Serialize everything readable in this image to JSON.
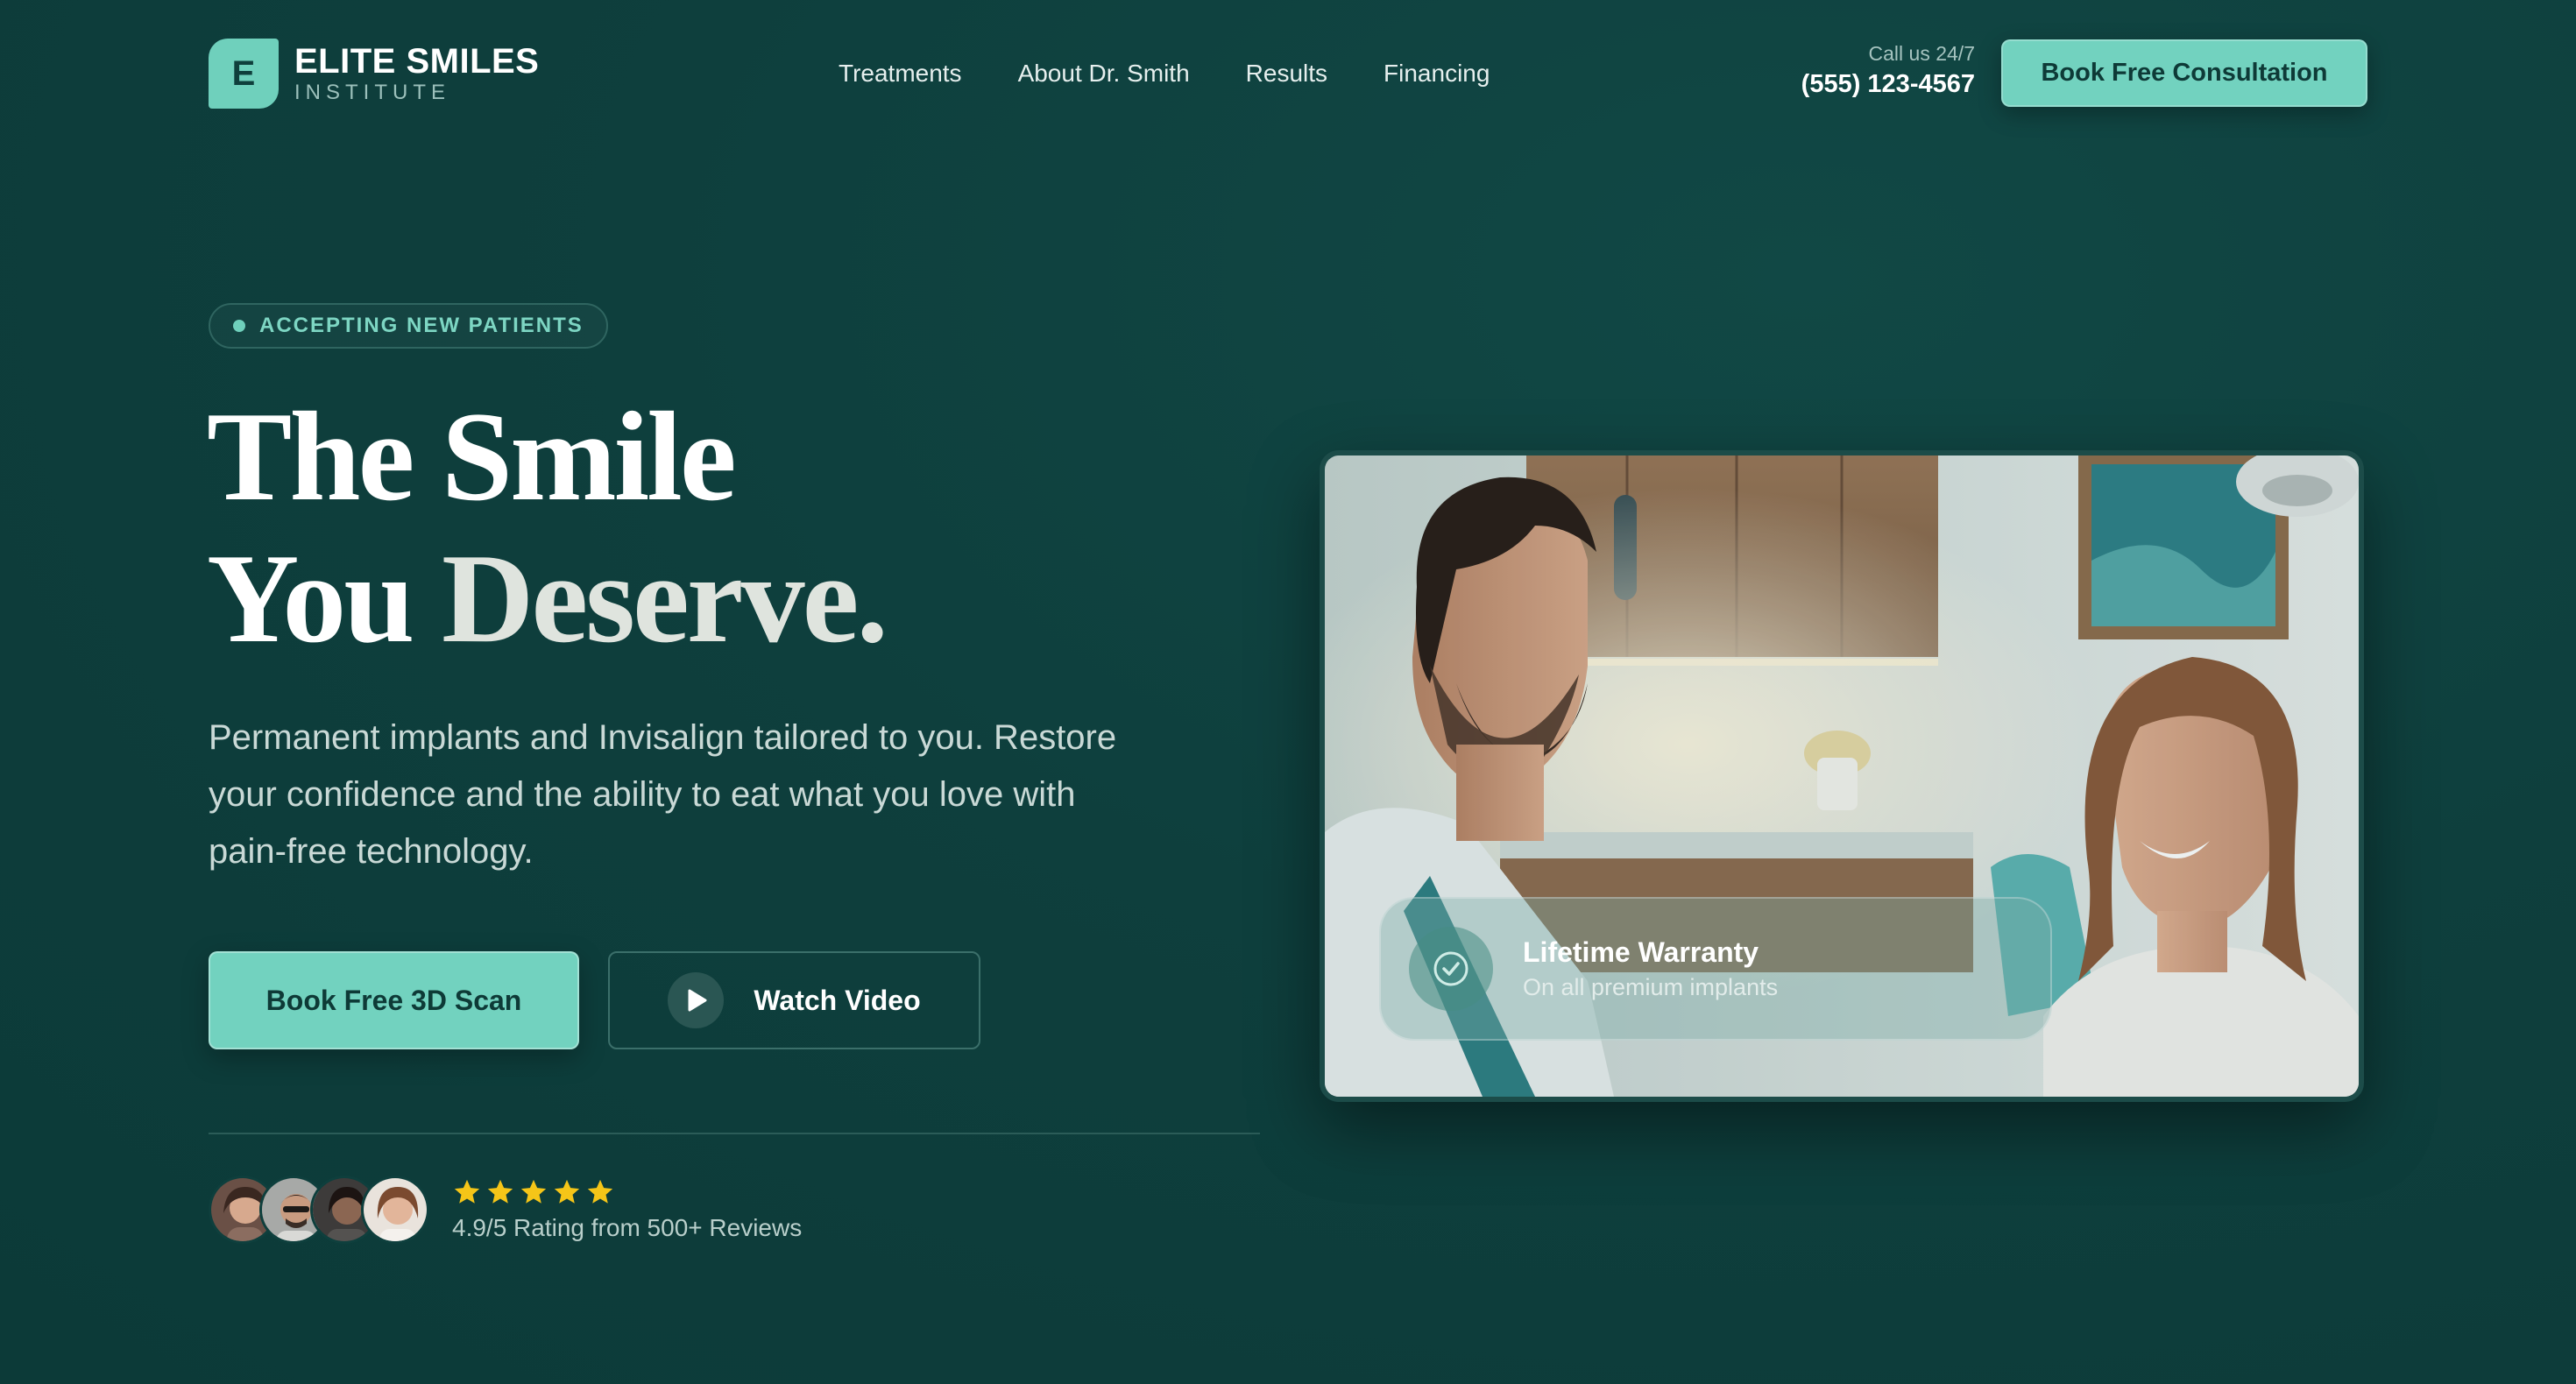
{
  "brand": {
    "mark": "E",
    "name": "ELITE SMILES",
    "tagline": "INSTITUTE",
    "accent_color": "#72d2bf",
    "background_color": "#0e3f3d"
  },
  "nav": {
    "items": [
      {
        "label": "Treatments"
      },
      {
        "label": "About Dr. Smith"
      },
      {
        "label": "Results"
      },
      {
        "label": "Financing"
      }
    ]
  },
  "contact": {
    "label": "Call us 24/7",
    "phone": "(555) 123-4567"
  },
  "header_cta": {
    "label": "Book Free Consultation"
  },
  "hero": {
    "badge": "ACCEPTING NEW PATIENTS",
    "headline_line1": "The Smile",
    "headline_line2_a": "You ",
    "headline_line2_b": "Deserve.",
    "subtitle": "Permanent implants and Invisalign tailored to you. Restore your confidence and the ability to eat what you love with pain-free technology.",
    "primary_cta": "Book Free 3D Scan",
    "secondary_cta": "Watch Video"
  },
  "social_proof": {
    "stars": 5,
    "star_color": "#f5c518",
    "rating_text": "4.9/5 Rating from 500+ Reviews",
    "avatar_count": 4
  },
  "feature_card": {
    "title": "Lifetime Warranty",
    "subtitle": "On all premium implants",
    "icon": "check-circle-icon"
  }
}
